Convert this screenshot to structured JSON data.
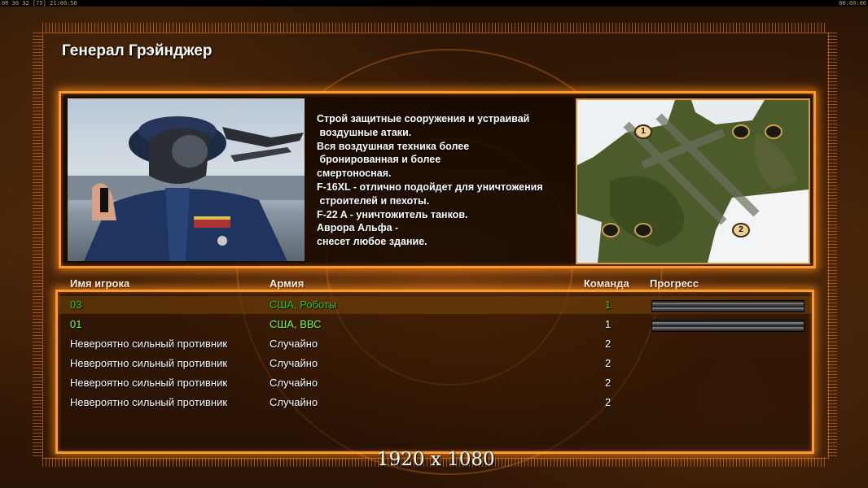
{
  "status_bar": {
    "left": "0R 30 32 [75] 21:00:50",
    "right": "00:00:00"
  },
  "general": {
    "title": "Генерал Грэйнджер",
    "description": "Строй защитные сооружения и устраивай\n воздушные атаки.\nВся воздушная техника более\n бронированная и более\nсмертоносная.\nF-16XL - отлично подойдет для уничтожения\n строителей и пехоты.\nF-22 A - уничтожитель танков.\nАврора Альфа -\nснесет любое здание."
  },
  "minimap": {
    "markers": [
      "1",
      "2"
    ]
  },
  "table": {
    "headers": {
      "player": "Имя игрока",
      "army": "Армия",
      "team": "Команда",
      "progress": "Прогресс"
    },
    "rows": [
      {
        "name": "03",
        "army": "США, Роботы",
        "team": "1",
        "progress": 1.0
      },
      {
        "name": "01",
        "army": "США, ВВС",
        "team": "1",
        "progress": 1.0
      },
      {
        "name": "Невероятно сильный противник",
        "army": "Случайно",
        "team": "2"
      },
      {
        "name": "Невероятно сильный противник",
        "army": "Случайно",
        "team": "2"
      },
      {
        "name": "Невероятно сильный противник",
        "army": "Случайно",
        "team": "2"
      },
      {
        "name": "Невероятно сильный противник",
        "army": "Случайно",
        "team": "2"
      }
    ]
  },
  "resolution_label": "1920 x 1080",
  "colors": {
    "accent_orange": "#ff9a2a",
    "player_green": "#2fbf2f",
    "player_bright_green": "#7cff3a"
  }
}
